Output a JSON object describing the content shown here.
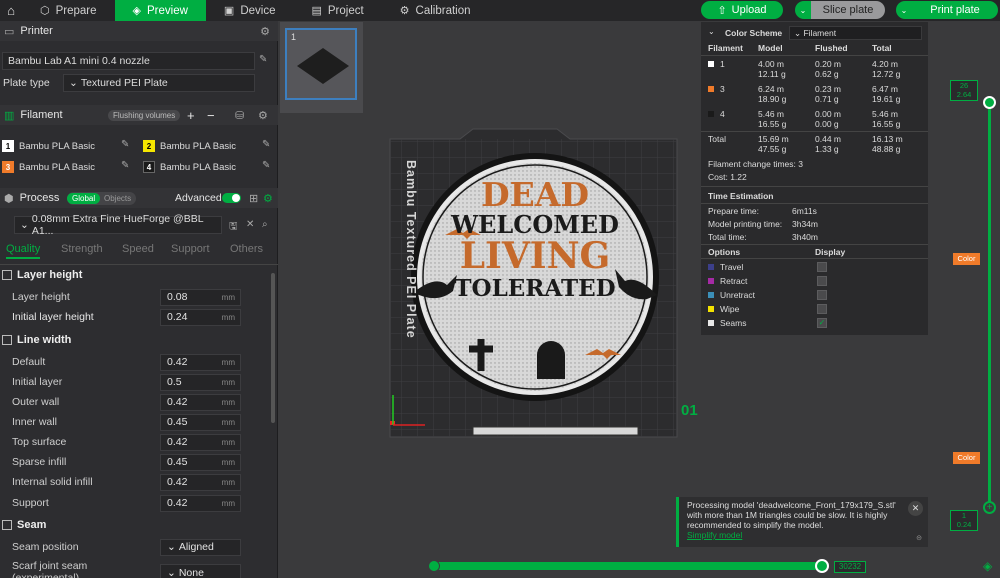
{
  "topbar": {
    "tabs": [
      {
        "label": "Prepare",
        "icon": "cube-icon"
      },
      {
        "label": "Preview",
        "icon": "layers-icon"
      },
      {
        "label": "Device",
        "icon": "device-icon"
      },
      {
        "label": "Project",
        "icon": "project-icon"
      },
      {
        "label": "Calibration",
        "icon": "calibration-icon"
      }
    ],
    "upload_label": "Upload",
    "slice_label": "Slice plate",
    "print_label": "Print plate"
  },
  "printer": {
    "header": "Printer",
    "model": "Bambu Lab A1 mini 0.4 nozzle",
    "plate_type_label": "Plate type",
    "plate_type": "Textured PEI Plate"
  },
  "filament": {
    "header": "Filament",
    "flushing_label": "Flushing volumes",
    "slots": [
      {
        "num": "1",
        "name": "Bambu PLA Basic",
        "color": "#ffffff"
      },
      {
        "num": "2",
        "name": "Bambu PLA Basic",
        "color": "#f5e600"
      },
      {
        "num": "3",
        "name": "Bambu PLA Basic",
        "color": "#f07b2a"
      },
      {
        "num": "4",
        "name": "Bambu PLA Basic",
        "color": "#1a1a1a"
      }
    ]
  },
  "process": {
    "header": "Process",
    "global_label": "Global",
    "objects_label": "Objects",
    "advanced_label": "Advanced",
    "profile": "0.08mm Extra Fine HueForge @BBL A1...",
    "tabs": [
      "Quality",
      "Strength",
      "Speed",
      "Support",
      "Others"
    ],
    "groups": {
      "layer_height": "Layer height",
      "line_width": "Line width",
      "seam": "Seam"
    },
    "layer_height_rows": [
      {
        "label": "Layer height",
        "value": "0.08",
        "unit": "mm"
      },
      {
        "label": "Initial layer height",
        "value": "0.24",
        "unit": "mm"
      }
    ],
    "line_width_rows": [
      {
        "label": "Default",
        "value": "0.42",
        "unit": "mm"
      },
      {
        "label": "Initial layer",
        "value": "0.5",
        "unit": "mm"
      },
      {
        "label": "Outer wall",
        "value": "0.42",
        "unit": "mm"
      },
      {
        "label": "Inner wall",
        "value": "0.45",
        "unit": "mm"
      },
      {
        "label": "Top surface",
        "value": "0.42",
        "unit": "mm"
      },
      {
        "label": "Sparse infill",
        "value": "0.45",
        "unit": "mm"
      },
      {
        "label": "Internal solid infill",
        "value": "0.42",
        "unit": "mm"
      },
      {
        "label": "Support",
        "value": "0.42",
        "unit": "mm"
      }
    ],
    "seam_rows": [
      {
        "label": "Seam position",
        "value": "Aligned"
      },
      {
        "label": "Scarf joint seam (experimental)",
        "value": "None"
      }
    ]
  },
  "plate": {
    "number": "1",
    "bed_text": "Bambu Textured PEI Plate",
    "plate_index": "01",
    "design_lines": [
      "DEAD",
      "WELCOMED",
      "LIVING",
      "TOLERATED"
    ]
  },
  "legend": {
    "title": "Color Scheme",
    "scheme": "Filament",
    "columns": [
      "Filament",
      "Model",
      "Flushed",
      "Total"
    ],
    "rows": [
      {
        "id": "1",
        "color": "#ffffff",
        "model": [
          "4.00 m",
          "12.11 g"
        ],
        "flushed": [
          "0.20 m",
          "0.62 g"
        ],
        "total": [
          "4.20 m",
          "12.72 g"
        ]
      },
      {
        "id": "3",
        "color": "#f07b2a",
        "model": [
          "6.24 m",
          "18.90 g"
        ],
        "flushed": [
          "0.23 m",
          "0.71 g"
        ],
        "total": [
          "6.47 m",
          "19.61 g"
        ]
      },
      {
        "id": "4",
        "color": "#1a1a1a",
        "model": [
          "5.46 m",
          "16.55 g"
        ],
        "flushed": [
          "0.00 m",
          "0.00 g"
        ],
        "total": [
          "5.46 m",
          "16.55 g"
        ]
      }
    ],
    "total_label": "Total",
    "total": {
      "model": [
        "15.69 m",
        "47.55 g"
      ],
      "flushed": [
        "0.44 m",
        "1.33 g"
      ],
      "total": [
        "16.13 m",
        "48.88 g"
      ]
    },
    "filament_change": "Filament change times:  3",
    "cost": "Cost:  1.22",
    "time_title": "Time Estimation",
    "times": [
      {
        "label": "Prepare time:",
        "value": "6m11s"
      },
      {
        "label": "Model printing time:",
        "value": "3h34m"
      },
      {
        "label": "Total time:",
        "value": "3h40m"
      }
    ],
    "options_label": "Options",
    "display_label": "Display",
    "options": [
      {
        "label": "Travel",
        "color": "#3c3f8a",
        "checked": false
      },
      {
        "label": "Retract",
        "color": "#a52aa5",
        "checked": false
      },
      {
        "label": "Unretract",
        "color": "#3b8fb8",
        "checked": false
      },
      {
        "label": "Wipe",
        "color": "#f3e200",
        "checked": false
      },
      {
        "label": "Seams",
        "color": "#e8e8e8",
        "checked": true
      }
    ]
  },
  "layer_slider": {
    "top_values": [
      "26",
      "2.64"
    ],
    "bottom_values": [
      "1",
      "0.24"
    ],
    "color_label_1": "Color",
    "color_label_2": "Color"
  },
  "move_slider": {
    "value": "30232"
  },
  "notification": {
    "text": "Processing model 'deadwelcome_Front_179x179_S.stl' with more than 1M triangles could be slow. It is highly recommended to simplify the model.",
    "link": "Simplify model"
  },
  "colors": {
    "accent": "#00ae42",
    "orange": "#f07b2a"
  }
}
